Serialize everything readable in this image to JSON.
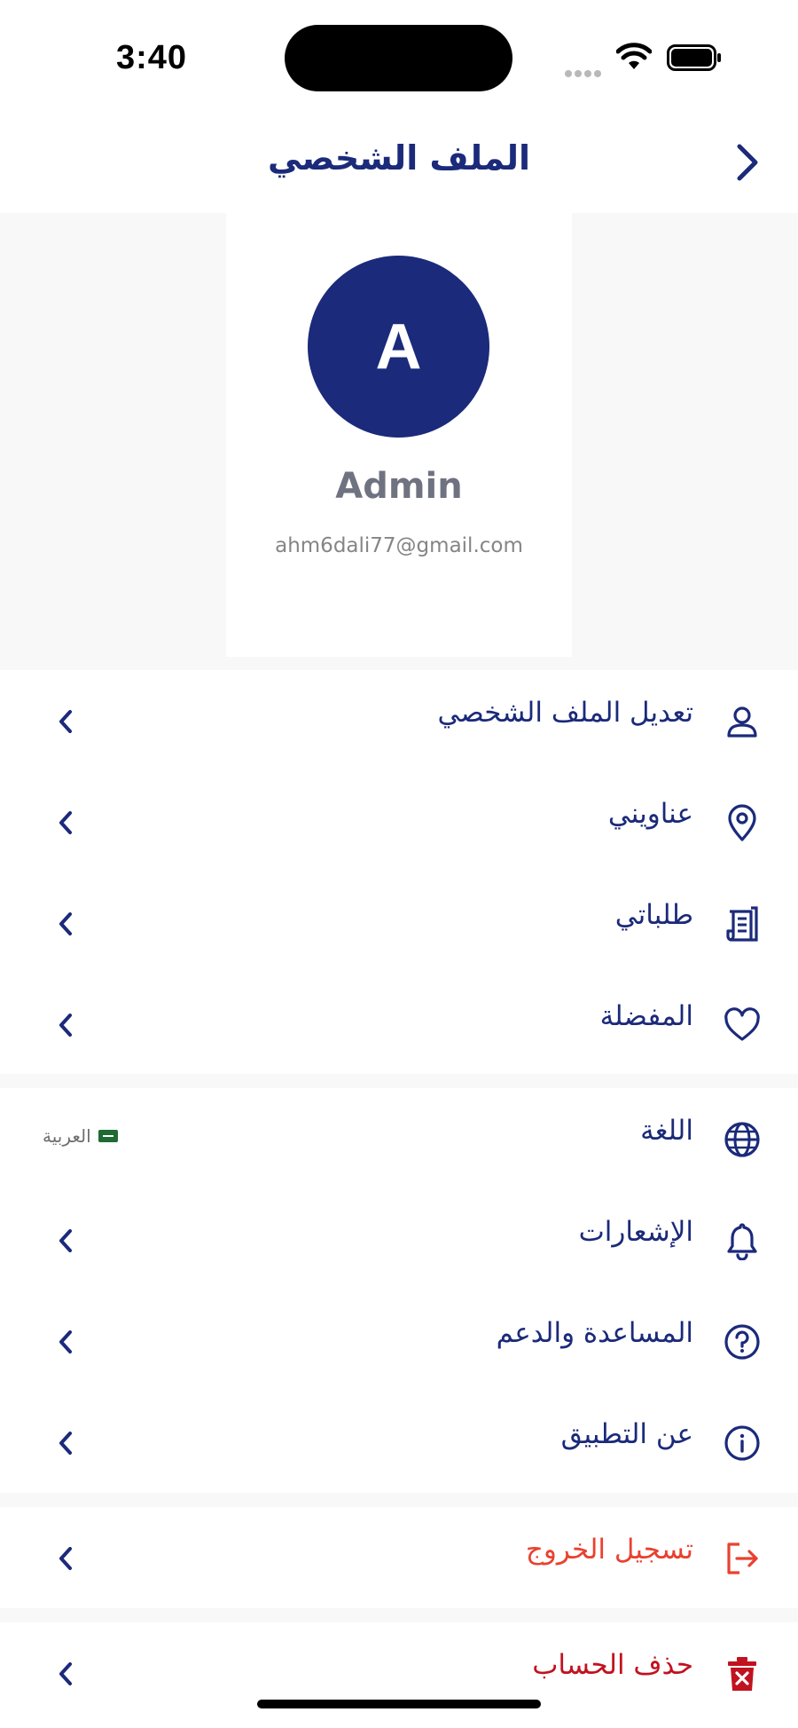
{
  "status_bar": {
    "time": "3:40"
  },
  "header": {
    "title": "الملف الشخصي"
  },
  "profile": {
    "avatar_letter": "A",
    "name": "Admin",
    "email": "ahm6dali77@gmail.com"
  },
  "menu_account": [
    {
      "label": "تعديل الملف الشخصي",
      "icon": "user-icon"
    },
    {
      "label": "عناويني",
      "icon": "location-pin-icon"
    },
    {
      "label": "طلباتي",
      "icon": "receipt-icon"
    },
    {
      "label": "المفضلة",
      "icon": "heart-icon"
    }
  ],
  "menu_settings": [
    {
      "label": "اللغة",
      "icon": "globe-icon",
      "value": "العربية"
    },
    {
      "label": "الإشعارات",
      "icon": "bell-icon"
    },
    {
      "label": "المساعدة والدعم",
      "icon": "help-icon"
    },
    {
      "label": "عن التطبيق",
      "icon": "info-icon"
    }
  ],
  "logout": {
    "label": "تسجيل الخروج",
    "icon": "logout-icon"
  },
  "delete_account": {
    "label": "حذف الحساب",
    "icon": "trash-icon"
  },
  "colors": {
    "primary": "#1b2a7a",
    "logout": "#e9412f",
    "delete": "#c1121f",
    "background": "#f8f8f8"
  }
}
